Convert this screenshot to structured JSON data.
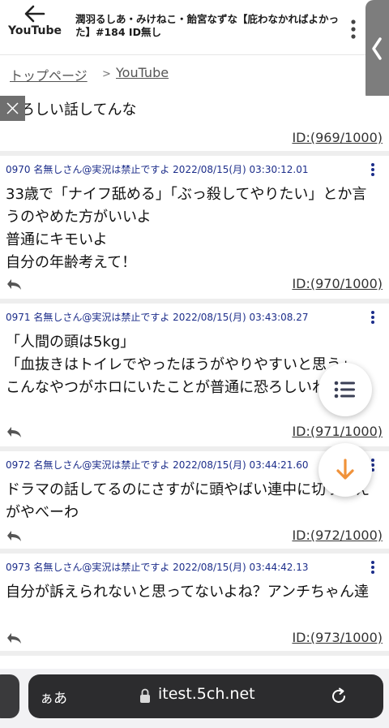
{
  "header": {
    "back_label": "YouTube",
    "title": "潤羽るしあ・みけねこ・飴宮なずな【庇わなかればよかった】#184 ID無し"
  },
  "breadcrumb": {
    "home": "トップページ",
    "separator": ">",
    "current": "YouTube"
  },
  "posts": [
    {
      "meta": "",
      "lines": [
        "恐ろしい話してんな"
      ],
      "id": "ID:(969/1000)"
    },
    {
      "meta": "0970 名無しさん@実況は禁止ですよ 2022/08/15(月) 03:30:12.01",
      "lines": [
        "33歳で「ナイフ舐める」「ぶっ殺してやりたい」とか言うのやめた方がいいよ",
        "普通にキモいよ",
        "自分の年齢考えて！"
      ],
      "id": "ID:(970/1000)"
    },
    {
      "meta": "0971 名無しさん@実況は禁止ですよ 2022/08/15(月) 03:43:08.27",
      "lines": [
        "「人間の頭は5kg」",
        "「血抜きはトイレでやったほうがやりやすいと思う」",
        "こんなやつがホロにいたことが普通に恐ろしいわ"
      ],
      "id": "ID:(971/1000)"
    },
    {
      "meta": "0972 名無しさん@実況は禁止ですよ 2022/08/15(月) 03:44:21.60",
      "lines": [
        "ドラマの話してるのにさすがに頭やばい連中に切り替えがやべーわ"
      ],
      "id": "ID:(972/1000)"
    },
    {
      "meta": "0973 名無しさん@実況は禁止ですよ 2022/08/15(月) 03:44:42.13",
      "lines": [
        "自分が訴えられないと思ってないよね？アンチちゃん達"
      ],
      "id": "ID:(973/1000)"
    }
  ],
  "browser": {
    "aa_label": "ぁあ",
    "url": "itest.5ch.net"
  },
  "colors": {
    "meta_text": "#1c2d8a",
    "fab_accent": "#f0923a",
    "side_tab": "#7d7d7d",
    "address_bar": "#2c2c2e"
  },
  "icons": {
    "back": "back-arrow-icon",
    "side": "chevron-left-icon",
    "reply": "reply-arrow-icon",
    "list": "list-icon",
    "down": "arrow-down-icon",
    "lock": "lock-icon",
    "reload": "reload-icon"
  }
}
